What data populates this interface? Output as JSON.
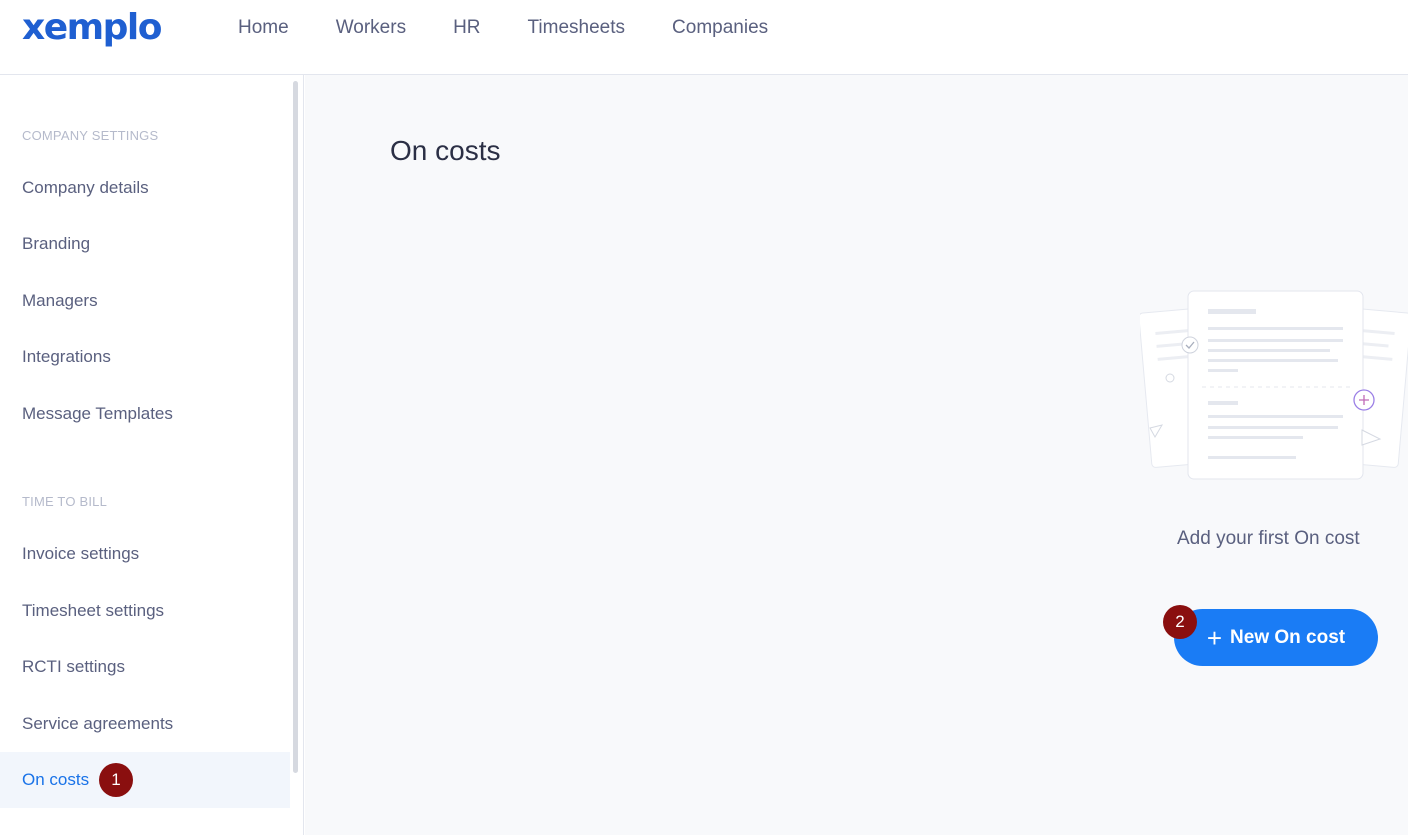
{
  "app": {
    "logo": "xemplo"
  },
  "nav": {
    "items": [
      {
        "label": "Home"
      },
      {
        "label": "Workers"
      },
      {
        "label": "HR"
      },
      {
        "label": "Timesheets"
      },
      {
        "label": "Companies"
      }
    ]
  },
  "sidebar": {
    "sections": [
      {
        "label": "COMPANY SETTINGS",
        "items": [
          {
            "label": "Company details"
          },
          {
            "label": "Branding"
          },
          {
            "label": "Managers"
          },
          {
            "label": "Integrations"
          },
          {
            "label": "Message Templates"
          }
        ]
      },
      {
        "label": "TIME TO BILL",
        "items": [
          {
            "label": "Invoice settings"
          },
          {
            "label": "Timesheet settings"
          },
          {
            "label": "RCTI settings"
          },
          {
            "label": "Service agreements"
          },
          {
            "label": "On costs",
            "active": true
          }
        ]
      }
    ]
  },
  "main": {
    "title": "On costs",
    "empty_message": "Add your first On cost",
    "new_button_label": "New On cost"
  },
  "annotations": {
    "badge_1": "1",
    "badge_2": "2"
  },
  "colors": {
    "accent": "#1a7cf5",
    "active_text": "#1a73e8",
    "badge": "#8a0f0f",
    "logo": "#1f5fd1"
  }
}
